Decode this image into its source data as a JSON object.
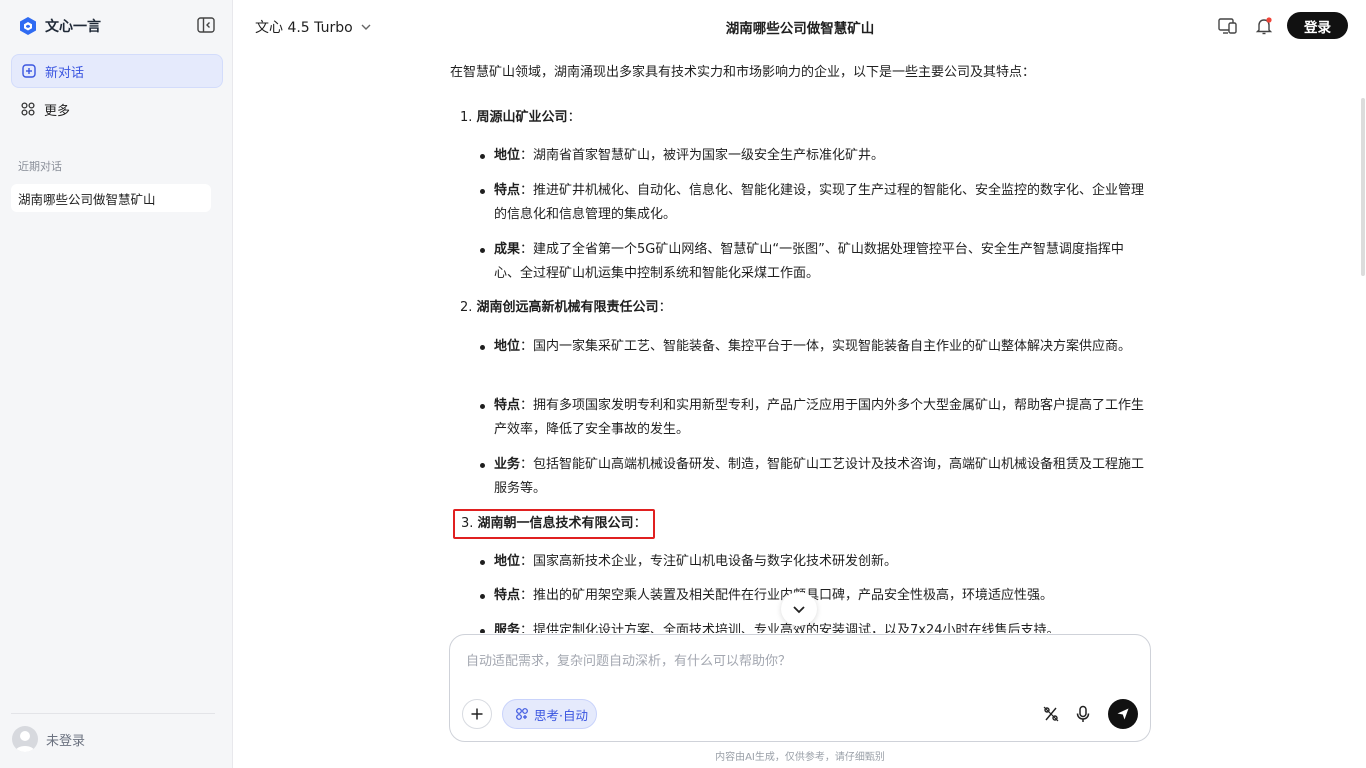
{
  "sidebar": {
    "brand_name": "文心一言",
    "new_chat_label": "新对话",
    "more_label": "更多",
    "recent_title": "近期对话",
    "history": [
      {
        "label": "湖南哪些公司做智慧矿山"
      }
    ],
    "user_label": "未登录"
  },
  "header": {
    "model": "文心 4.5 Turbo",
    "title": "湖南哪些公司做智慧矿山",
    "login_label": "登录"
  },
  "answer": {
    "intro": "在智慧矿山领域，湖南涌现出多家具有技术实力和市场影响力的企业，以下是一些主要公司及其特点：",
    "companies": [
      {
        "num": "1.",
        "name": "周源山矿业公司",
        "suffix": "：",
        "points": [
          {
            "key": "地位",
            "sep": "：",
            "text": "湖南省首家智慧矿山，被评为国家一级安全生产标准化矿井。"
          },
          {
            "key": "特点",
            "sep": "：",
            "text": "推进矿井机械化、自动化、信息化、智能化建设，实现了生产过程的智能化、安全监控的数字化、企业管理的信息化和信息管理的集成化。"
          },
          {
            "key": "成果",
            "sep": "：",
            "text": "建成了全省第一个5G矿山网络、智慧矿山“一张图”、矿山数据处理管控平台、安全生产智慧调度指挥中心、全过程矿山机运集中控制系统和智能化采煤工作面。"
          }
        ]
      },
      {
        "num": "2.",
        "name": "湖南创远高新机械有限责任公司",
        "suffix": "：",
        "points": [
          {
            "key": "地位",
            "sep": "：",
            "text": "国内一家集采矿工艺、智能装备、集控平台于一体，实现智能装备自主作业的矿山整体解决方案供应商。"
          },
          {
            "key": "特点",
            "sep": "：",
            "text": "拥有多项国家发明专利和实用新型专利，产品广泛应用于国内外多个大型金属矿山，帮助客户提高了工作生产效率，降低了安全事故的发生。"
          },
          {
            "key": "业务",
            "sep": "：",
            "text": "包括智能矿山高端机械设备研发、制造，智能矿山工艺设计及技术咨询，高端矿山机械设备租赁及工程施工服务等。"
          }
        ]
      },
      {
        "num": "3.",
        "name": "湖南朝一信息技术有限公司",
        "suffix": "：",
        "points": [
          {
            "key": "地位",
            "sep": "：",
            "text": "国家高新技术企业，专注矿山机电设备与数字化技术研发创新。"
          },
          {
            "key": "特点",
            "sep": "：",
            "text": "推出的矿用架空乘人装置及相关配件在行业内颇具口碑，产品安全性极高，环境适应性强。"
          },
          {
            "key": "服务",
            "sep": "：",
            "text": "提供定制化设计方案、全面技术培训、专业高效的安装调试，以及7x24小时在线售后支持。"
          }
        ]
      }
    ]
  },
  "input": {
    "placeholder": "自动适配需求，复杂问题自动深析，有什么可以帮助你？",
    "think_label": "思考·自动"
  },
  "footer_note": "内容由AI生成，仅供参考，请仔细甄别",
  "colors": {
    "accent": "#3a55e0",
    "highlight_border": "#e02020",
    "login_bg": "#111111"
  },
  "icons": [
    "logo-icon",
    "sidebar-collapse-icon",
    "new-chat-icon",
    "more-grid-icon",
    "avatar-icon",
    "chevron-down-icon",
    "device-icon",
    "bell-icon",
    "plus-icon",
    "think-icon",
    "no-format-icon",
    "mic-icon",
    "send-icon"
  ]
}
